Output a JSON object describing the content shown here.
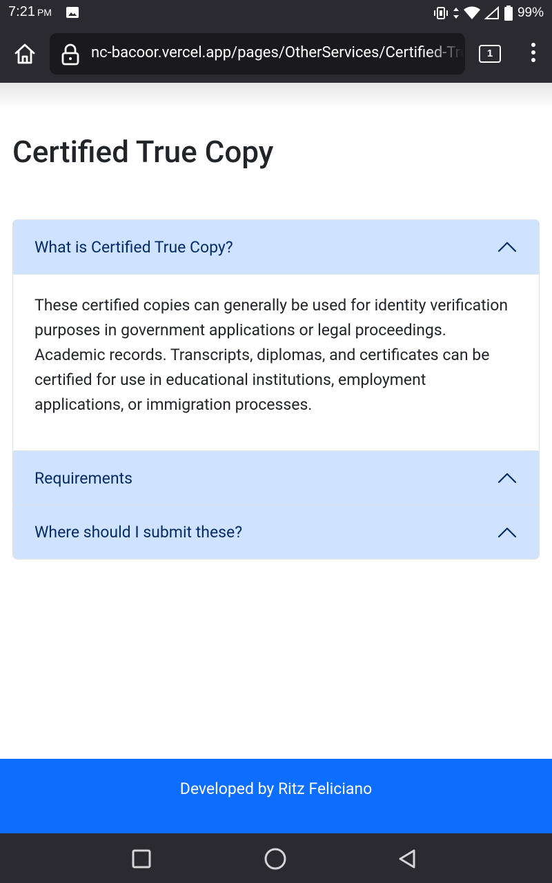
{
  "status_bar": {
    "time": "7:21",
    "ampm": "PM",
    "battery": "99%"
  },
  "browser": {
    "url": "nc-bacoor.vercel.app/pages/OtherServices/Certified-True-Copy",
    "tab_count": "1"
  },
  "page": {
    "title": "Certified True Copy"
  },
  "accordion": {
    "items": [
      {
        "label": "What is Certified True Copy?",
        "expanded": true,
        "body": "These certified copies can generally be used for identity verification purposes in government applications or legal proceedings. Academic records. Transcripts, diplomas, and certificates can be certified for use in educational institutions, employment applications, or immigration processes."
      },
      {
        "label": "Requirements",
        "expanded": false
      },
      {
        "label": "Where should I submit these?",
        "expanded": false
      }
    ]
  },
  "footer": {
    "text": "Developed by Ritz Feliciano"
  },
  "colors": {
    "accordion_header_bg": "#cfe2ff",
    "accordion_header_text": "#052c65",
    "footer_bg": "#0d6efd",
    "chrome_bg": "#2b2a30"
  },
  "icons": {
    "status": [
      "gallery-icon",
      "vibrate-icon",
      "data-arrows-icon",
      "wifi-icon",
      "cell-signal-icon",
      "battery-icon"
    ],
    "toolbar": [
      "home-icon",
      "lock-icon",
      "tab-switcher-icon",
      "overflow-menu-icon"
    ],
    "nav": [
      "recents-icon",
      "home-circle-icon",
      "back-icon"
    ]
  }
}
